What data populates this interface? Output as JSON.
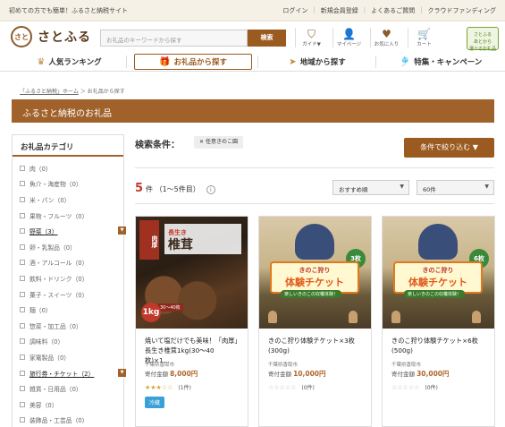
{
  "topbar": {
    "tagline": "初めての方でも簡単！ふるさと納税サイト",
    "links": [
      "ログイン",
      "新規会員登録",
      "よくあるご質問",
      "クラウドファンディング"
    ]
  },
  "header": {
    "logo_mark": "さと",
    "logo_text": "さとふる",
    "search_placeholder": "お礼品のキーワードから探す",
    "search_button": "検索",
    "icons": [
      {
        "name": "guide-icon",
        "glyph": "⛉",
        "label": "ガイド▼"
      },
      {
        "name": "mypage-icon",
        "glyph": "👤",
        "label": "マイページ"
      },
      {
        "name": "favorite-icon",
        "glyph": "♥",
        "label": "お気に入り"
      },
      {
        "name": "cart-icon",
        "glyph": "🛒",
        "label": "カート"
      }
    ],
    "later_badge": "さとふる\nあとから\n選べるお礼品"
  },
  "nav": [
    {
      "label": "人気ランキング",
      "glyph": "♛"
    },
    {
      "label": "お礼品から探す",
      "glyph": "🎁"
    },
    {
      "label": "地域から探す",
      "glyph": "➤"
    },
    {
      "label": "特集・キャンペーン",
      "glyph": "🎐"
    }
  ],
  "breadcrumb": {
    "home": "「ふるさと納税」ホーム",
    "sep": "＞",
    "current": "お礼品から探す"
  },
  "page_title": "ふるさと納税のお礼品",
  "sidebar": {
    "title": "お礼品カテゴリ",
    "categories": [
      {
        "label": "肉（0）",
        "bold": false
      },
      {
        "label": "魚介・海産物（0）",
        "bold": false
      },
      {
        "label": "米・パン（0）",
        "bold": false
      },
      {
        "label": "果物・フルーツ（0）",
        "bold": false
      },
      {
        "label": "野菜（3）",
        "bold": true
      },
      {
        "label": "卵・乳製品（0）",
        "bold": false
      },
      {
        "label": "酒・アルコール（0）",
        "bold": false
      },
      {
        "label": "飲料・ドリンク（0）",
        "bold": false
      },
      {
        "label": "菓子・スイーツ（0）",
        "bold": false
      },
      {
        "label": "麺（0）",
        "bold": false
      },
      {
        "label": "惣菜・加工品（0）",
        "bold": false
      },
      {
        "label": "調味料（0）",
        "bold": false
      },
      {
        "label": "家電製品（0）",
        "bold": false
      },
      {
        "label": "旅行券・チケット（2）",
        "bold": true
      },
      {
        "label": "雑貨・日用品（0）",
        "bold": false
      },
      {
        "label": "美容（0）",
        "bold": false
      },
      {
        "label": "装飾品・工芸品（0）",
        "bold": false
      }
    ],
    "expand_glyph": "▼"
  },
  "conditions": {
    "label": "検索条件：",
    "chip": "任意きのこ園",
    "chip_close": "✕",
    "filter_button": "条件で絞り込む",
    "filter_arrow": "▼"
  },
  "results": {
    "count": "5",
    "count_suffix": "件 （1～5件目）",
    "info": "i",
    "sort": "おすすめ順",
    "per_page": "60件",
    "arrow": "▼"
  },
  "products": [
    {
      "title": "焼いて塩だけでも美味！「肉厚」長生き椎茸1kg(30〜40枚)×1…",
      "location": "千葉県香取市",
      "price_label": "寄付金額",
      "price": "8,000円",
      "stars": "★★★☆☆",
      "reviews": "(1件)",
      "tag": "冷蔵",
      "img_tag_small": "長生き",
      "img_tag_main": "椎茸",
      "img_kg": "1kg",
      "img_size": "30〜40枚",
      "img_ribbon": "肉厚"
    },
    {
      "title": "きのこ狩り体験チケット×3枚(300g)",
      "location": "千葉県香取市",
      "price_label": "寄付金額",
      "price": "10,000円",
      "stars": "☆☆☆☆☆",
      "reviews": "(0件)",
      "ticket_top": "きのこ狩り",
      "ticket_main": "体験チケット",
      "ticket_sub": "楽しいきのこの収穫体験！",
      "badge": "3枚"
    },
    {
      "title": "きのこ狩り体験チケット×6枚(500g)",
      "location": "千葉県香取市",
      "price_label": "寄付金額",
      "price": "30,000円",
      "stars": "☆☆☆☆☆",
      "reviews": "(0件)",
      "ticket_top": "きのこ狩り",
      "ticket_main": "体験チケット",
      "ticket_sub": "楽しいきのこの収穫体験！",
      "badge": "6枚"
    }
  ],
  "colors": {
    "brand": "#9a5a20",
    "accent_red": "#c0392b",
    "star": "#d4a73a",
    "chill": "#3aa0d8"
  }
}
